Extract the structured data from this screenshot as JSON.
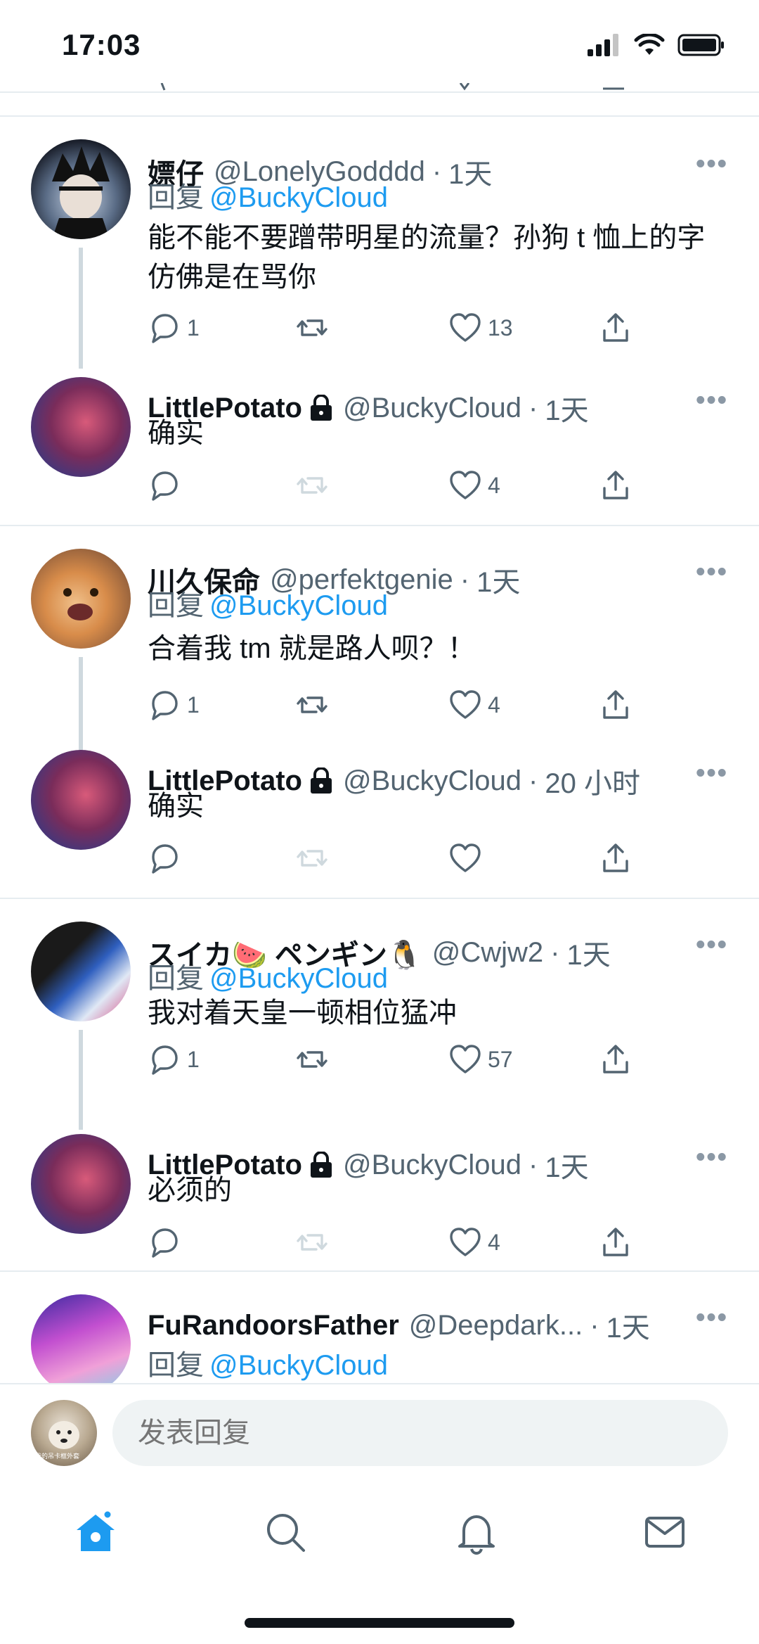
{
  "status": {
    "time": "17:03"
  },
  "tweets": [
    {
      "name": "嫖仔",
      "handle": "@LonelyGodddd",
      "time": "1天",
      "reply_prefix": "回复",
      "reply_to": "@BuckyCloud",
      "text": "能不能不要蹭带明星的流量？孙狗 t 恤上的字仿佛是在骂你",
      "replies": "1",
      "retweets": "",
      "likes": "13"
    },
    {
      "name": "LittlePotato",
      "handle": "@BuckyCloud",
      "time": "1天",
      "text": "确实",
      "replies": "",
      "retweets": "",
      "likes": "4"
    },
    {
      "name": "川久保命",
      "handle": "@perfektgenie",
      "time": "1天",
      "reply_prefix": "回复",
      "reply_to": "@BuckyCloud",
      "text": "合着我 tm 就是路人呗？！",
      "replies": "1",
      "retweets": "",
      "likes": "4"
    },
    {
      "name": "LittlePotato",
      "handle": "@BuckyCloud",
      "time": "20 小时",
      "text": "确实",
      "replies": "",
      "retweets": "",
      "likes": ""
    },
    {
      "name": "スイカ🍉 ペンギン🐧",
      "handle": "@Cwjw2",
      "time": "1天",
      "reply_prefix": "回复",
      "reply_to": "@BuckyCloud",
      "text": "我对着天皇一顿相位猛冲",
      "replies": "1",
      "retweets": "",
      "likes": "57"
    },
    {
      "name": "LittlePotato",
      "handle": "@BuckyCloud",
      "time": "1天",
      "text": "必须的",
      "replies": "",
      "retweets": "",
      "likes": "4"
    },
    {
      "name": "FuRandoorsFather",
      "handle": "@Deepdark...",
      "time": "1天",
      "reply_prefix": "回复",
      "reply_to": "@BuckyCloud"
    }
  ],
  "composer": {
    "placeholder": "发表回复",
    "avatar_caption": "我的吊卡框外套"
  },
  "tabbar": {
    "icons": [
      "home-icon",
      "search-icon",
      "notifications-icon",
      "messages-icon"
    ]
  },
  "colors": {
    "accent": "#1d9bf0",
    "muted": "#536471",
    "divider": "#e6ecf0"
  }
}
